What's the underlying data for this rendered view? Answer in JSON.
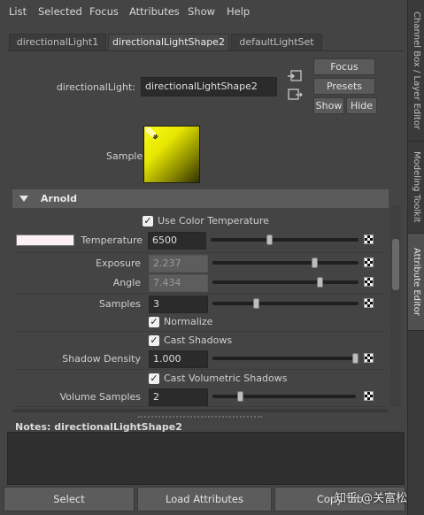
{
  "menu": [
    "List",
    "Selected",
    "Focus",
    "Attributes",
    "Show",
    "Help"
  ],
  "side_tabs": [
    "Channel Box / Layer Editor",
    "Modeling Toolkit",
    "Attribute Editor"
  ],
  "node_tabs": [
    "directionalLight1",
    "directionalLightShape2",
    "defaultLightSet"
  ],
  "node": {
    "label": "directionalLight:",
    "value": "directionalLightShape2"
  },
  "buttons": {
    "focus": "Focus",
    "presets": "Presets",
    "show": "Show",
    "hide": "Hide"
  },
  "sample_label": "Sample",
  "section_title": "Arnold",
  "attributes": {
    "use_color_temperature": "Use Color Temperature",
    "temperature_label": "Temperature",
    "temperature_value": "6500",
    "exposure_label": "Exposure",
    "exposure_value": "2.237",
    "angle_label": "Angle",
    "angle_value": "7.434",
    "samples_label": "Samples",
    "samples_value": "3",
    "normalize": "Normalize",
    "cast_shadows": "Cast Shadows",
    "shadow_density_label": "Shadow Density",
    "shadow_density_value": "1.000",
    "cast_volumetric_shadows": "Cast Volumetric Shadows",
    "volume_samples_label": "Volume Samples",
    "volume_samples_value": "2"
  },
  "slider_levels": {
    "temperature": 0.4,
    "exposure": 0.7,
    "angle": 0.74,
    "samples": 0.3,
    "shadow_density": 1.0,
    "volume_samples": 0.2
  },
  "notes": {
    "label": "Notes:",
    "value": "directionalLightShape2"
  },
  "bottom_buttons": [
    "Select",
    "Load Attributes",
    "Copy Tab"
  ],
  "watermark": "知乎 @关富松",
  "colors": {
    "accent_sample": "#e6e600",
    "temperature_swatch": "#fdf0f4"
  }
}
